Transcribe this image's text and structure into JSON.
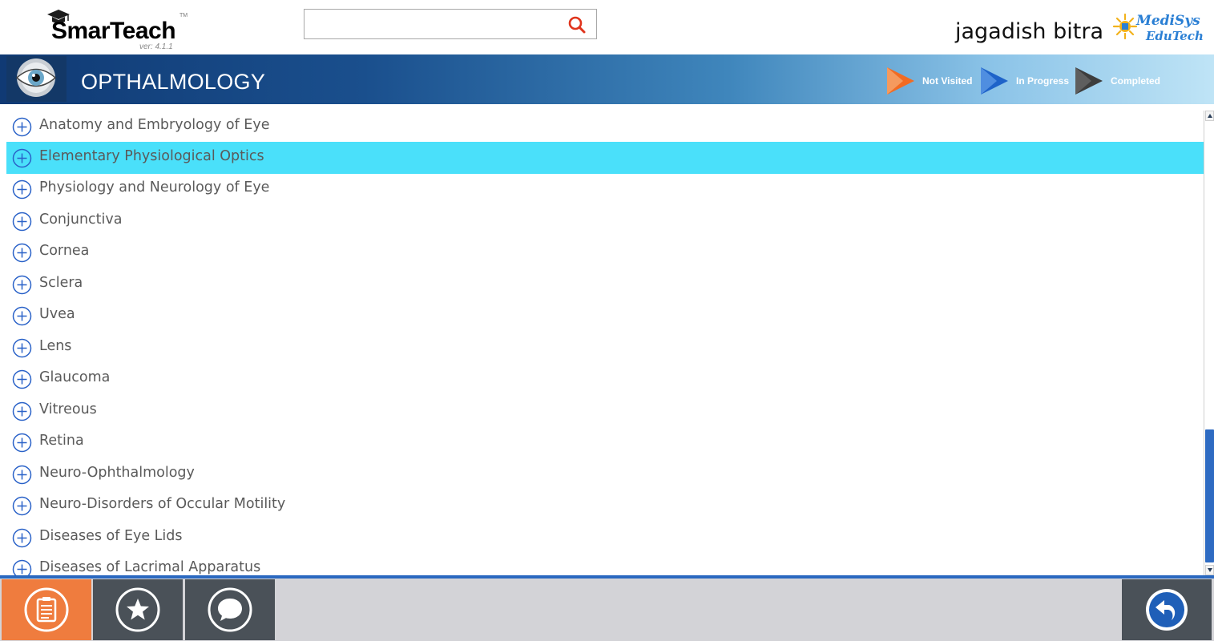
{
  "app": {
    "logo_name": "SmarTeach",
    "logo_tm": "TM",
    "version": "ver: 4.1.1",
    "brand_line1": "MediSys",
    "brand_line2": "EduTech"
  },
  "search": {
    "value": "",
    "placeholder": "",
    "icon": "search-icon"
  },
  "user": {
    "name": "jagadish bitra"
  },
  "subject": {
    "title": "OPTHALMOLOGY"
  },
  "legend": [
    {
      "label": "Not Visited",
      "color": "#f26b22"
    },
    {
      "label": "In Progress",
      "color": "#1e63c9"
    },
    {
      "label": "Completed",
      "color": "#3d3d3d"
    }
  ],
  "topics": [
    {
      "label": "Anatomy and Embryology of Eye",
      "selected": false
    },
    {
      "label": "Elementary Physiological Optics",
      "selected": true
    },
    {
      "label": "Physiology and Neurology of Eye",
      "selected": false
    },
    {
      "label": "Conjunctiva",
      "selected": false
    },
    {
      "label": "Cornea",
      "selected": false
    },
    {
      "label": "Sclera",
      "selected": false
    },
    {
      "label": "Uvea",
      "selected": false
    },
    {
      "label": "Lens",
      "selected": false
    },
    {
      "label": "Glaucoma",
      "selected": false
    },
    {
      "label": "Vitreous",
      "selected": false
    },
    {
      "label": "Retina",
      "selected": false
    },
    {
      "label": "Neuro-Ophthalmology",
      "selected": false
    },
    {
      "label": "Neuro-Disorders of Occular Motility",
      "selected": false
    },
    {
      "label": "Diseases of Eye Lids",
      "selected": false
    },
    {
      "label": "Diseases of Lacrimal Apparatus",
      "selected": false
    }
  ],
  "bottom_nav": {
    "items": [
      {
        "icon": "notes-icon",
        "active": true
      },
      {
        "icon": "star-icon",
        "active": false
      },
      {
        "icon": "chat-bubble-icon",
        "active": false
      }
    ],
    "back": {
      "icon": "back-arrow-icon"
    }
  },
  "colors": {
    "accent_orange": "#ef7c3e",
    "selected_row": "#4ae0fa",
    "header_dark": "#103a74",
    "plus_icon": "#2a62c8"
  }
}
